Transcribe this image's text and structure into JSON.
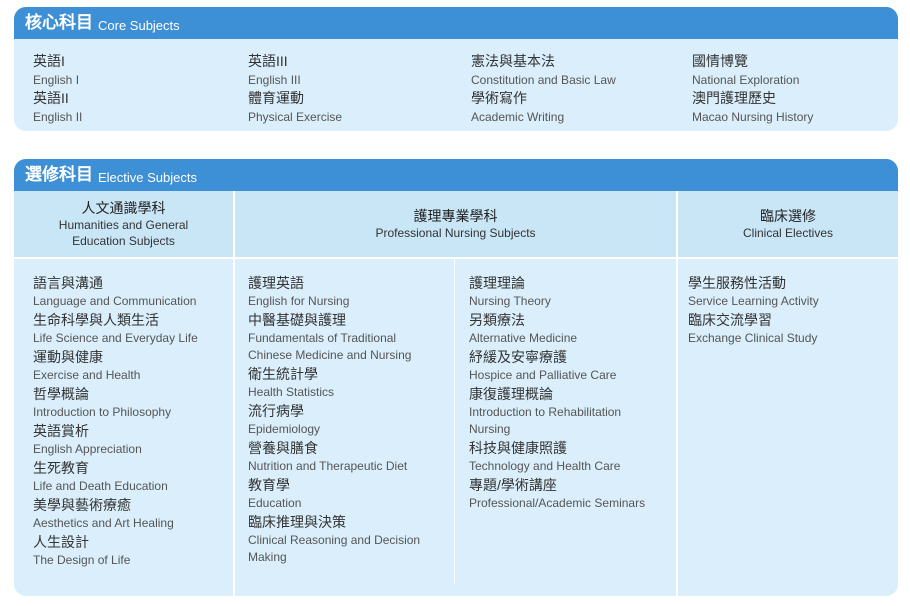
{
  "core": {
    "title_zh": "核心科目",
    "title_en": "Core Subjects",
    "columns": [
      {
        "items": [
          {
            "zh": "英語I",
            "en": "English I"
          },
          {
            "zh": "英語II",
            "en": "English II"
          }
        ]
      },
      {
        "items": [
          {
            "zh": "英語III",
            "en": "English III"
          },
          {
            "zh": "體育運動",
            "en": "Physical Exercise"
          }
        ]
      },
      {
        "items": [
          {
            "zh": "憲法與基本法",
            "en": "Constitution and Basic Law"
          },
          {
            "zh": "學術寫作",
            "en": "Academic Writing"
          }
        ]
      },
      {
        "items": [
          {
            "zh": "國情博覽",
            "en": "National Exploration"
          },
          {
            "zh": "澳門護理歷史",
            "en": "Macao Nursing History"
          }
        ]
      }
    ]
  },
  "elective": {
    "title_zh": "選修科目",
    "title_en": "Elective Subjects",
    "headers": [
      {
        "zh": "人文通識學科",
        "en_line1": "Humanities and General",
        "en_line2": "Education Subjects"
      },
      {
        "zh": "護理專業學科",
        "en_line1": "Professional Nursing Subjects",
        "en_line2": ""
      },
      {
        "zh": "臨床選修",
        "en_line1": "Clinical Electives",
        "en_line2": ""
      }
    ],
    "humanities": [
      {
        "zh": "語言與溝通",
        "en": "Language and Communication"
      },
      {
        "zh": "生命科學與人類生活",
        "en": "Life Science and Everyday Life"
      },
      {
        "zh": "運動與健康",
        "en": "Exercise and Health"
      },
      {
        "zh": "哲學概論",
        "en": "Introduction to Philosophy"
      },
      {
        "zh": "英語賞析",
        "en": "English Appreciation"
      },
      {
        "zh": "生死教育",
        "en": "Life and Death Education"
      },
      {
        "zh": "美學與藝術療癒",
        "en": "Aesthetics and Art Healing"
      },
      {
        "zh": "人生設計",
        "en": "The Design of Life"
      }
    ],
    "nursing_a": [
      {
        "zh": "護理英語",
        "en": "English for Nursing"
      },
      {
        "zh": "中醫基礎與護理",
        "en": "Fundamentals of Traditional Chinese Medicine and Nursing"
      },
      {
        "zh": "衛生統計學",
        "en": "Health Statistics"
      },
      {
        "zh": "流行病學",
        "en": "Epidemiology"
      },
      {
        "zh": "營養與膳食",
        "en": "Nutrition and Therapeutic Diet"
      },
      {
        "zh": "教育學",
        "en": "Education"
      },
      {
        "zh": "臨床推理與決策",
        "en": "Clinical Reasoning and Decision Making"
      }
    ],
    "nursing_b": [
      {
        "zh": "護理理論",
        "en": "Nursing Theory"
      },
      {
        "zh": "另類療法",
        "en": "Alternative Medicine"
      },
      {
        "zh": "紓緩及安寧療護",
        "en": "Hospice and Palliative Care"
      },
      {
        "zh": "康復護理概論",
        "en": "Introduction to Rehabilitation Nursing"
      },
      {
        "zh": "科技與健康照護",
        "en": "Technology and Health Care"
      },
      {
        "zh": "專題/學術講座",
        "en": "Professional/Academic Seminars"
      }
    ],
    "clinical": [
      {
        "zh": "學生服務性活動",
        "en": "Service Learning Activity"
      },
      {
        "zh": "臨床交流學習",
        "en": "Exchange Clinical Study"
      }
    ]
  }
}
